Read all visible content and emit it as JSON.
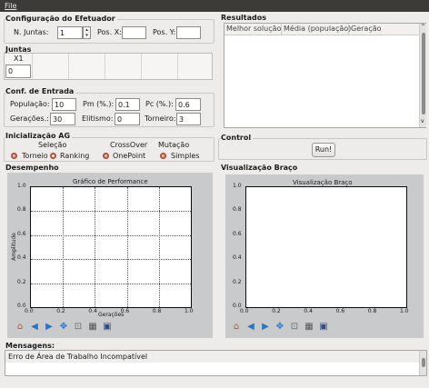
{
  "menu": {
    "file": "File"
  },
  "efetuador": {
    "title": "Configuração do Efetuador",
    "n_juntas_label": "N. Juntas:",
    "n_juntas_value": "1",
    "pos_x_label": "Pos. X:",
    "pos_x_value": "",
    "pos_y_label": "Pos. Y:",
    "pos_y_value": ""
  },
  "juntas": {
    "title": "Juntas",
    "column": "X1",
    "value": "0"
  },
  "entrada": {
    "title": "Conf. de Entrada",
    "populacao_label": "População:",
    "populacao_value": "10",
    "pm_label": "Pm (%.):",
    "pm_value": "0.1",
    "pc_label": "Pc (%.):",
    "pc_value": "0.6",
    "geracoes_label": "Gerações.:",
    "geracoes_value": "30",
    "elitismo_label": "Elitismo:",
    "elitismo_value": "0",
    "torneiro_label": "Torneiro:",
    "torneiro_value": "3"
  },
  "inicializacao": {
    "title": "Inicialização AG",
    "selecao": "Seleção",
    "crossover": "CrossOver",
    "mutacao": "Mutação",
    "torneio": "Torneio",
    "ranking": "Ranking",
    "onepoint": "OnePoint",
    "simples": "Simples"
  },
  "resultados": {
    "title": "Resultados",
    "columns": [
      "Melhor solução",
      "Média (população)",
      "Geração"
    ]
  },
  "control": {
    "title": "Control",
    "run": "Run!"
  },
  "desempenho": {
    "title": "Desempenho",
    "chart_title": "Gráfico de Performance",
    "xlabel": "Gerações",
    "ylabel": "Amplitude"
  },
  "visualizacao": {
    "title": "Visualização Braço",
    "chart_title": "Visualização Braço"
  },
  "ticks": {
    "x": [
      "0.0",
      "0.2",
      "0.4",
      "0.6",
      "0.8",
      "1.0"
    ],
    "y": [
      "0.0",
      "0.2",
      "0.4",
      "0.6",
      "0.8",
      "1.0"
    ]
  },
  "mensagens": {
    "title": "Mensagens:",
    "text": "Erro de Área de Trabalho Incompatível"
  },
  "chart_data": [
    {
      "type": "line",
      "title": "Gráfico de Performance",
      "xlabel": "Gerações",
      "ylabel": "Amplitude",
      "xlim": [
        0,
        1
      ],
      "ylim": [
        0,
        1
      ],
      "grid": true,
      "series": []
    },
    {
      "type": "line",
      "title": "Visualização Braço",
      "xlabel": "",
      "ylabel": "",
      "xlim": [
        0,
        1
      ],
      "ylim": [
        0,
        1
      ],
      "grid": false,
      "series": []
    }
  ]
}
